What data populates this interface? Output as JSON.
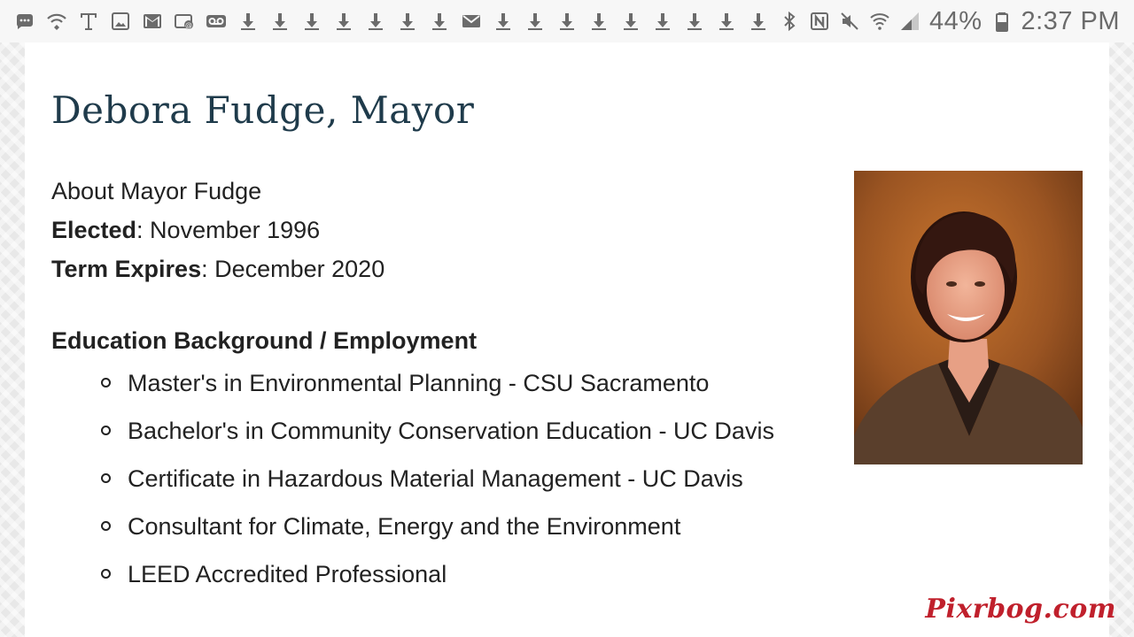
{
  "status_bar": {
    "left_icons": [
      "message-dots-icon",
      "wifi-call-icon",
      "tmobile-icon",
      "image-icon",
      "gmail-icon",
      "email-icon",
      "voicemail-icon",
      "download-icon",
      "download-icon",
      "download-icon",
      "download-icon",
      "download-icon",
      "download-icon",
      "download-icon",
      "mail-icon",
      "download-icon",
      "download-icon",
      "download-icon",
      "download-icon",
      "download-icon",
      "download-icon",
      "download-icon",
      "download-icon",
      "download-icon"
    ],
    "right_icons": [
      "bluetooth-icon",
      "nfc-icon",
      "mute-icon",
      "wifi-icon",
      "signal-icon"
    ],
    "battery": "44%",
    "time": "2:37 PM"
  },
  "page": {
    "title": "Debora Fudge, Mayor",
    "about": "About Mayor Fudge",
    "elected_label": "Elected",
    "elected_value": ": November 1996",
    "term_label": "Term Expires",
    "term_value": ": December 2020",
    "section_heading": "Education Background / Employment",
    "education": [
      "Master's in Environmental Planning - CSU Sacramento",
      "Bachelor's in Community Conservation Education - UC Davis",
      "Certificate in Hazardous Material Management - UC Davis",
      "Consultant for Climate, Energy and the Environment",
      "LEED Accredited Professional"
    ]
  },
  "watermark": "Pixrbog.com",
  "colors": {
    "title": "#1f3b4b",
    "body_text": "#222222",
    "status_icons": "#6b6b6b",
    "watermark": "#c0202c"
  }
}
